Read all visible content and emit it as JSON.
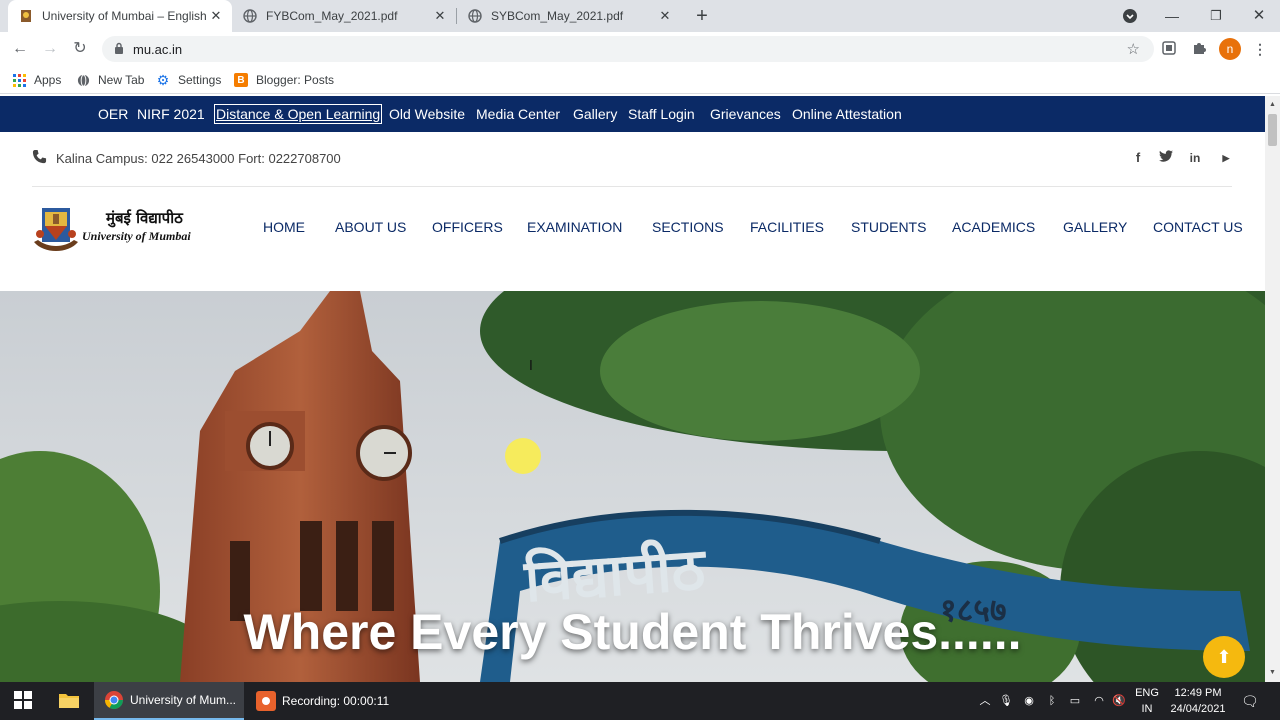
{
  "browser": {
    "tabs": [
      {
        "title": "University of Mumbai – English",
        "icon": "university-favicon",
        "active": true
      },
      {
        "title": "FYBCom_May_2021.pdf",
        "icon": "globe-icon",
        "active": false
      },
      {
        "title": "SYBCom_May_2021.pdf",
        "icon": "globe-icon",
        "active": false
      }
    ],
    "new_tab_label": "+",
    "url": "mu.ac.in",
    "profile_initial": "n",
    "bookmarks": [
      {
        "label": "Apps",
        "icon": "apps-grid-icon"
      },
      {
        "label": "New Tab",
        "icon": "globe-icon"
      },
      {
        "label": "Settings",
        "icon": "gear-icon"
      },
      {
        "label": "Blogger: Posts",
        "icon": "blogger-icon"
      }
    ]
  },
  "site": {
    "top_links": [
      "OER",
      "NIRF 2021",
      "Distance & Open Learning",
      "Old Website",
      "Media Center",
      "Gallery",
      "Staff Login",
      "Grievances",
      "Online Attestation"
    ],
    "contact_text": "Kalina Campus: 022 26543000 Fort: 0222708700",
    "social": [
      {
        "name": "facebook-icon",
        "glyph": "f"
      },
      {
        "name": "twitter-icon",
        "glyph": "t"
      },
      {
        "name": "linkedin-icon",
        "glyph": "in"
      },
      {
        "name": "youtube-icon",
        "glyph": "▶"
      }
    ],
    "logo": {
      "marathi": "मुंबई विद्यापीठ",
      "english": "University of Mumbai"
    },
    "menu": [
      "HOME",
      "ABOUT US",
      "OFFICERS",
      "EXAMINATION",
      "SECTIONS",
      "FACILITIES",
      "STUDENTS",
      "ACADEMICS",
      "GALLERY",
      "CONTACT US"
    ],
    "hero": {
      "arch_text": "विद्यापीठ",
      "arch_year": "१८५७",
      "title": "Where Every Student Thrives......"
    }
  },
  "taskbar": {
    "items": [
      {
        "label": "University of Mum...",
        "icon": "chrome-icon"
      },
      {
        "label": "Recording:  00:00:11",
        "icon": "recording-icon"
      }
    ],
    "lang": "ENG",
    "region": "IN",
    "time": "12:49 PM",
    "date": "24/04/2021"
  },
  "colors": {
    "nav_bg": "#0b2a66",
    "accent": "#f5b90f",
    "profile": "#e8710a"
  }
}
